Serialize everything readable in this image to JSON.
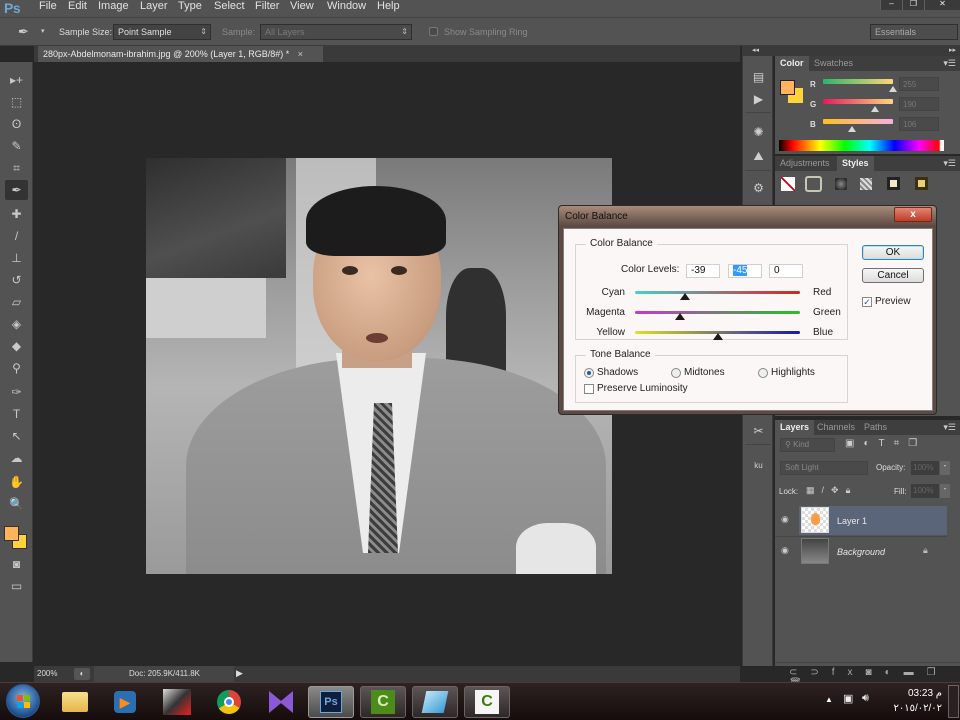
{
  "app": {
    "logo": "Ps",
    "menu": [
      "File",
      "Edit",
      "Image",
      "Layer",
      "Type",
      "Select",
      "Filter",
      "View",
      "Window",
      "Help"
    ],
    "window_controls": {
      "minimize": "–",
      "restore": "❐",
      "close": "✕"
    }
  },
  "options_bar": {
    "sample_size_label": "Sample Size:",
    "sample_size_value": "Point Sample",
    "sample_label": "Sample:",
    "sample_value": "All Layers",
    "sampling_ring_label": "Show Sampling Ring",
    "workspace": "Essentials"
  },
  "document": {
    "tab_title": "280px-Abdelmonam-ibrahim.jpg @ 200% (Layer 1, RGB/8#) *",
    "close": "×"
  },
  "tools": [
    "move-tool",
    "marquee-tool",
    "lasso-tool",
    "quick-select-tool",
    "crop-tool",
    "eyedropper-tool",
    "healing-brush-tool",
    "brush-tool",
    "clone-stamp-tool",
    "history-brush-tool",
    "eraser-tool",
    "paint-bucket-tool",
    "blur-tool",
    "dodge-tool",
    "pen-tool",
    "type-tool",
    "path-select-tool",
    "shape-tool",
    "hand-tool",
    "zoom-tool"
  ],
  "tool_glyphs": [
    "▸+",
    "⬚",
    "ʘ",
    "✎",
    "⌗",
    "✒",
    "✚",
    "/",
    "⊥",
    "↺",
    "▱",
    "◈",
    "◆",
    "⚲",
    "✑",
    "T",
    "↖",
    "☁",
    "✋",
    "🔍"
  ],
  "colors": {
    "foreground": "#ffb35c",
    "background": "#ffd43b"
  },
  "status": {
    "zoom": "200%",
    "doc": "Doc: 205.9K/411.8K",
    "arrow": "▶"
  },
  "color_panel": {
    "tabs": [
      "Color",
      "Swatches"
    ],
    "active_tab": "Color",
    "channels": [
      {
        "label": "R",
        "value": "255",
        "fraction": 1.0
      },
      {
        "label": "G",
        "value": "190",
        "fraction": 0.745
      },
      {
        "label": "B",
        "value": "106",
        "fraction": 0.416
      }
    ]
  },
  "styles_panel": {
    "tabs": [
      "Adjustments",
      "Styles"
    ],
    "active_tab": "Styles"
  },
  "layers_panel": {
    "tabs": [
      "Layers",
      "Channels",
      "Paths"
    ],
    "active_tab": "Layers",
    "filter_label": "Kind",
    "blend_mode": "Soft Light",
    "opacity_label": "Opacity:",
    "opacity_value": "100%",
    "lock_label": "Lock:",
    "fill_label": "Fill:",
    "fill_value": "100%",
    "layers": [
      {
        "name": "Layer 1",
        "selected": true,
        "visible": true,
        "locked": false
      },
      {
        "name": "Background",
        "selected": false,
        "visible": true,
        "locked": true
      }
    ],
    "footer_icons": [
      "link-icon",
      "fx-icon",
      "mask-icon",
      "adjustment-icon",
      "group-folder-icon",
      "new-layer-icon",
      "trash-icon"
    ]
  },
  "dialog": {
    "title": "Color Balance",
    "close": "x",
    "color_balance_group": "Color Balance",
    "color_levels_label": "Color Levels:",
    "levels": [
      "-39",
      "-45",
      "0"
    ],
    "sliders": [
      {
        "left": "Cyan",
        "right": "Red",
        "value": -39
      },
      {
        "left": "Magenta",
        "right": "Green",
        "value": -45
      },
      {
        "left": "Yellow",
        "right": "Blue",
        "value": 0
      }
    ],
    "slider_range": [
      -100,
      100
    ],
    "tone_group": "Tone Balance",
    "tones": [
      {
        "label": "Shadows",
        "selected": true
      },
      {
        "label": "Midtones",
        "selected": false
      },
      {
        "label": "Highlights",
        "selected": false
      }
    ],
    "preserve_luminosity": {
      "label": "Preserve Luminosity",
      "checked": false
    },
    "ok": "OK",
    "cancel": "Cancel",
    "preview": {
      "label": "Preview",
      "checked": true
    }
  },
  "taskbar": {
    "apps": [
      "start-button",
      "explorer",
      "media-player",
      "video-app",
      "chrome",
      "visual-studio",
      "photoshop",
      "camtasia-recorder",
      "notepad-app",
      "camtasia-studio"
    ],
    "time": "03:23 م",
    "date": "٢٠١٥/٠٢/٠٢"
  }
}
